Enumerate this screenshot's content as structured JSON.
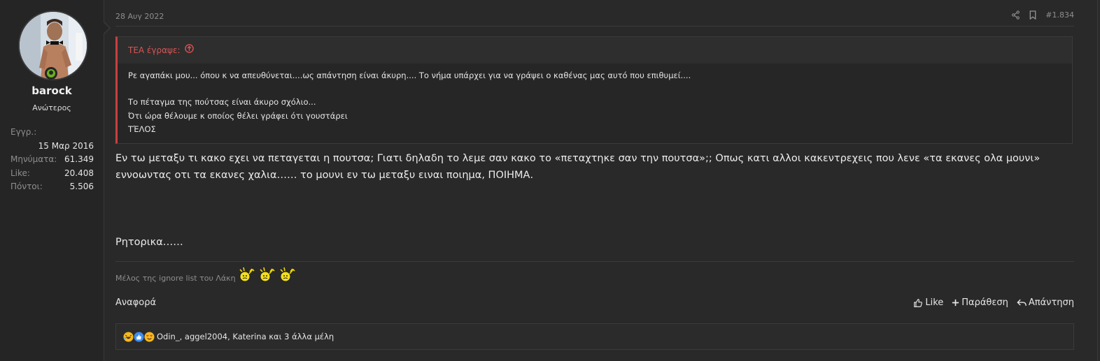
{
  "user": {
    "name": "barock",
    "title": "Ανώτερος",
    "stats": {
      "joined_label": "Εγγρ.:",
      "joined_value": "15 Μαρ 2016",
      "messages_label": "Μηνύματα:",
      "messages_value": "61.349",
      "likes_label": "Like:",
      "likes_value": "20.408",
      "points_label": "Πόντοι:",
      "points_value": "5.506"
    }
  },
  "post": {
    "date": "28 Αυγ 2022",
    "number": "#1.834",
    "quote": {
      "author_label": "TEA έγραψε:",
      "lines": [
        "Ρε αγαπάκι μου... όπου κ να απευθύνεται....ως απάντηση είναι άκυρη.... Το νήμα υπάρχει για να γράψει ο καθένας μας αυτό που επιθυμεί....",
        "Το πέταγμα της πούτσας είναι άκυρο σχόλιο...",
        "Ότι ώρα θέλουμε κ οποίος θέλει γράφει ότι γουστάρει",
        "ΤΈΛΟΣ"
      ]
    },
    "message": {
      "paragraph": "Εν τω μεταξυ τι κακο εχει να πεταγεται η πουτσα; Γιατι δηλαδη το λεμε σαν κακο το «πεταχτηκε σαν την πουτσα»;; Οπως κατι αλλοι κακεντρεχεις που λενε «τα εκανες ολα μουνι» εννοωντας οτι τα εκανες χαλια…… το μουνι εν τω μεταξυ ειναι ποιημα, ΠΟΙΗΜΑ.",
      "closing": "Ρητορικα……"
    },
    "signature": "Μέλος της ignore list του Λάκη",
    "footer": {
      "report": "Αναφορά",
      "like": "Like",
      "quote": "Παράθεση",
      "reply": "Απάντηση"
    },
    "reactions": {
      "text": "Odin_, aggel2004, Katerina και 3 άλλα μέλη"
    }
  },
  "colors": {
    "quote_accent": "#c94040",
    "online_status": "#6bb11c"
  },
  "icons": [
    "share-icon",
    "bookmark-icon",
    "arrow-up-circle-icon",
    "like-icon",
    "plus-icon",
    "reply-icon",
    "laugh-emoji-icon",
    "thumbs-up-emoji-icon",
    "love-emoji-icon",
    "smiley-icon"
  ]
}
